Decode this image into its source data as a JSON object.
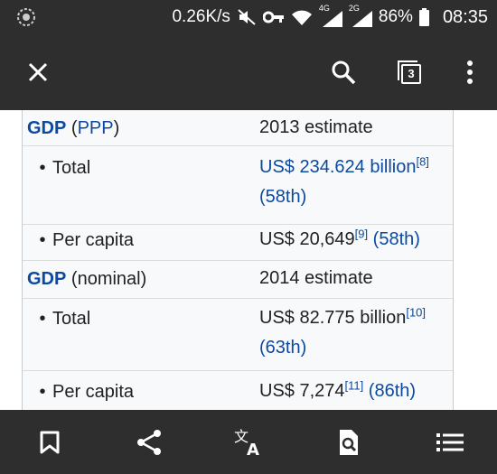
{
  "status_bar": {
    "speed": "0.26K/s",
    "net1": "4G",
    "net2": "2G",
    "battery": "86%",
    "time": "08:35"
  },
  "toolbar": {
    "tab_count": "3",
    "icons": [
      "close-icon",
      "search-icon",
      "tabs-icon",
      "more-icon"
    ]
  },
  "infobox": {
    "gdp_ppp": {
      "label_link": "GDP",
      "label_open": "(",
      "label_sub_link": "PPP",
      "label_close": ")",
      "value": "2013 estimate",
      "total_label": "Total",
      "total_value": "US$ 234.624 billion",
      "total_ref": "[8]",
      "total_rank": "(58th)",
      "per_capita_label": "Per capita",
      "per_capita_value": "US$ 20,649",
      "per_capita_ref": "[9]",
      "per_capita_rank": "(58th)"
    },
    "gdp_nominal": {
      "label_link": "GDP",
      "label_rest": "(nominal)",
      "value": "2014 estimate",
      "total_label": "Total",
      "total_value": "US$ 82.775 billion",
      "total_ref": "[10]",
      "total_rank": "(63th)",
      "per_capita_label": "Per capita",
      "per_capita_value": "US$ 7,274",
      "per_capita_ref": "[11]",
      "per_capita_rank": "(86th)"
    }
  },
  "bottom_bar": {
    "icons": [
      "bookmark-icon",
      "share-icon",
      "translate-icon",
      "find-in-page-icon",
      "contents-icon"
    ]
  },
  "colors": {
    "bar_bg": "#2e2e2e",
    "link": "#0b4aa0",
    "text": "#202122",
    "infobox_bg": "#f8f9fa"
  }
}
